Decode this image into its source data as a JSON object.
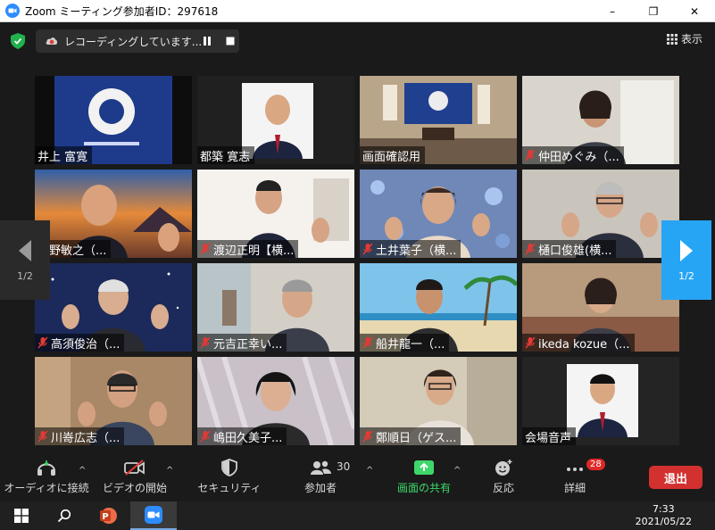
{
  "window": {
    "title": "Zoom ミーティング参加者ID：297618",
    "controls": [
      "–",
      "❐",
      "✕"
    ]
  },
  "recording": {
    "text": "レコーディングしています..."
  },
  "view_button": {
    "label": "表示"
  },
  "participants": [
    {
      "name": "井上 富寛",
      "muted": false,
      "scene": "banner"
    },
    {
      "name": "都築 寛志",
      "muted": false,
      "scene": "portrait"
    },
    {
      "name": "画面確認用",
      "muted": false,
      "scene": "room"
    },
    {
      "name": "仲田めぐみ（...",
      "muted": true,
      "scene": "shutters"
    },
    {
      "name": "狩野敏之（...",
      "muted": false,
      "scene": "sunset"
    },
    {
      "name": "渡辺正明【横...",
      "muted": true,
      "scene": "poster"
    },
    {
      "name": "土井葉子（横...",
      "muted": true,
      "scene": "flowers"
    },
    {
      "name": "樋口俊雄(横...",
      "muted": true,
      "scene": "plain"
    },
    {
      "name": "高須俊治（...",
      "muted": true,
      "scene": "space"
    },
    {
      "name": "元吉正幸い...",
      "muted": true,
      "scene": "curtain"
    },
    {
      "name": "船井龍一（...",
      "muted": true,
      "scene": "beach"
    },
    {
      "name": "ikeda kozue（...",
      "muted": true,
      "scene": "livingroom"
    },
    {
      "name": "川嵜広志（...",
      "muted": true,
      "scene": "wood"
    },
    {
      "name": "嶋田久美子...",
      "muted": true,
      "scene": "lace"
    },
    {
      "name": "鄭順日（ゲス...",
      "muted": true,
      "scene": "office"
    },
    {
      "name": "会場音声",
      "muted": false,
      "scene": "dark-portrait"
    }
  ],
  "pagination": {
    "left": "1/2",
    "right": "1/2"
  },
  "toolbar": {
    "audio": "オーディオに接続",
    "video": "ビデオの開始",
    "security": "セキュリティ",
    "participants": "参加者",
    "participant_count": "30",
    "share": "画面の共有",
    "reactions": "反応",
    "more": "詳細",
    "more_badge": "28",
    "leave": "退出"
  },
  "taskbar": {
    "time": "7:33",
    "date": "2021/05/22"
  },
  "colors": {
    "accent_blue": "#27a5f5",
    "share_green": "#3ed86a",
    "leave_red": "#d33030",
    "active_speaker": "#d7e86e"
  }
}
